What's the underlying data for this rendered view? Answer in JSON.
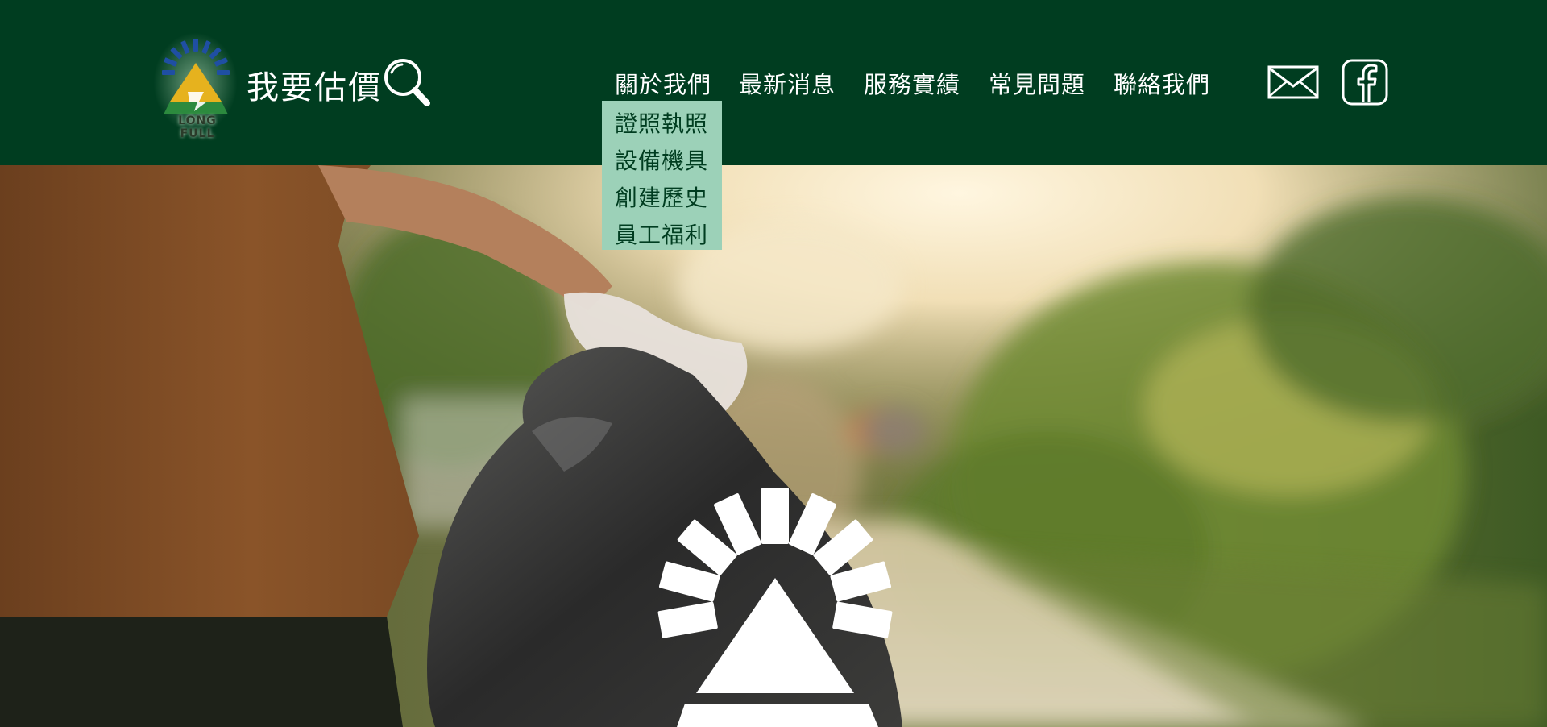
{
  "header": {
    "brand": {
      "logo_text": "LONG FULL"
    },
    "estimate_label": "我要估價"
  },
  "nav": {
    "items": [
      {
        "label": "關於我們"
      },
      {
        "label": "最新消息"
      },
      {
        "label": "服務實績"
      },
      {
        "label": "常見問題"
      },
      {
        "label": "聯絡我們"
      }
    ],
    "dropdown": {
      "items": [
        {
          "label": "證照執照"
        },
        {
          "label": "設備機具"
        },
        {
          "label": "創建歷史"
        },
        {
          "label": "員工福利"
        }
      ]
    }
  },
  "icons": [
    "search-icon",
    "mail-icon",
    "facebook-icon",
    "sun-logo-icon"
  ],
  "colors": {
    "header_bg": "#003d20",
    "dropdown_bg": "#9cd1b8",
    "logo_blue": "#1f4fa3",
    "logo_yellow": "#e6b21e",
    "logo_green": "#2c8a3e"
  }
}
